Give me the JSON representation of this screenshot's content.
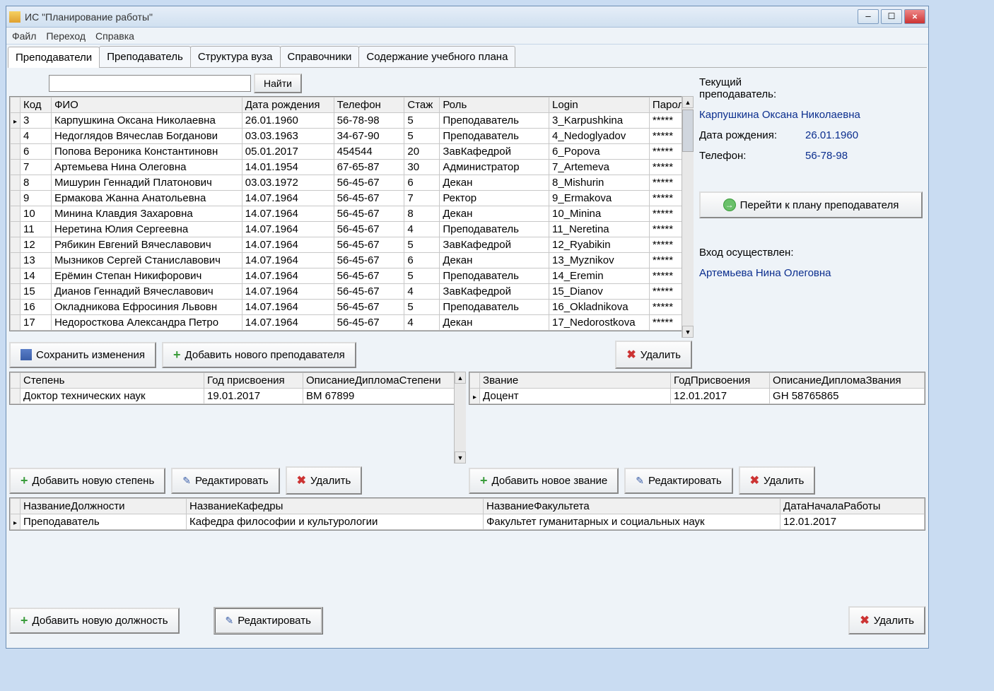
{
  "window": {
    "title": "ИС \"Планирование работы\""
  },
  "menu": {
    "file": "Файл",
    "nav": "Переход",
    "help": "Справка"
  },
  "tabs": {
    "t1": "Преподаватели",
    "t2": "Преподаватель",
    "t3": "Структура вуза",
    "t4": "Справочники",
    "t5": "Содержание учебного плана"
  },
  "search": {
    "btn": "Найти"
  },
  "teachers": {
    "headers": {
      "code": "Код",
      "fio": "ФИО",
      "dob": "Дата рождения",
      "tel": "Телефон",
      "stazh": "Стаж",
      "role": "Роль",
      "login": "Login",
      "pwd": "Пароль"
    },
    "rows": [
      {
        "code": "3",
        "fio": "Карпушкина Оксана  Николаевна",
        "dob": "26.01.1960",
        "tel": "56-78-98",
        "stazh": "5",
        "role": "Преподаватель",
        "login": "3_Karpushkina",
        "pwd": "*****"
      },
      {
        "code": "4",
        "fio": "Недоглядов Вячеслав  Богданови",
        "dob": "03.03.1963",
        "tel": "34-67-90",
        "stazh": "5",
        "role": "Преподаватель",
        "login": "4_Nedoglyadov",
        "pwd": "*****"
      },
      {
        "code": "6",
        "fio": "Попова Вероника  Константиновн",
        "dob": "05.01.2017",
        "tel": "454544",
        "stazh": "20",
        "role": "ЗавКафедрой",
        "login": "6_Popova",
        "pwd": "*****"
      },
      {
        "code": "7",
        "fio": "Артемьева Нина  Олеговна",
        "dob": "14.01.1954",
        "tel": "67-65-87",
        "stazh": "30",
        "role": "Администратор",
        "login": "7_Artemeva",
        "pwd": "*****"
      },
      {
        "code": "8",
        "fio": "Мишурин Геннадий  Платонович",
        "dob": "03.03.1972",
        "tel": "56-45-67",
        "stazh": "6",
        "role": "Декан",
        "login": "8_Mishurin",
        "pwd": "*****"
      },
      {
        "code": "9",
        "fio": "Ермакова Жанна Анатольевна",
        "dob": "14.07.1964",
        "tel": "56-45-67",
        "stazh": "7",
        "role": "Ректор",
        "login": "9_Ermakova",
        "pwd": "*****"
      },
      {
        "code": "10",
        "fio": "Минина Клавдия  Захаровна",
        "dob": "14.07.1964",
        "tel": "56-45-67",
        "stazh": "8",
        "role": "Декан",
        "login": "10_Minina",
        "pwd": "*****"
      },
      {
        "code": "11",
        "fio": "Неретина Юлия  Сергеевна",
        "dob": "14.07.1964",
        "tel": "56-45-67",
        "stazh": "4",
        "role": "Преподаватель",
        "login": "11_Neretina",
        "pwd": "*****"
      },
      {
        "code": "12",
        "fio": "Рябикин Евгений  Вячеславович",
        "dob": "14.07.1964",
        "tel": "56-45-67",
        "stazh": "5",
        "role": "ЗавКафедрой",
        "login": "12_Ryabikin",
        "pwd": "*****"
      },
      {
        "code": "13",
        "fio": "Мызников Сергей  Станиславович",
        "dob": "14.07.1964",
        "tel": "56-45-67",
        "stazh": "6",
        "role": "Декан",
        "login": "13_Myznikov",
        "pwd": "*****"
      },
      {
        "code": "14",
        "fio": "Ерёмин Степан  Никифорович",
        "dob": "14.07.1964",
        "tel": "56-45-67",
        "stazh": "5",
        "role": "Преподаватель",
        "login": "14_Eremin",
        "pwd": "*****"
      },
      {
        "code": "15",
        "fio": "Дианов Геннадий  Вячеславович",
        "dob": "14.07.1964",
        "tel": "56-45-67",
        "stazh": "4",
        "role": "ЗавКафедрой",
        "login": "15_Dianov",
        "pwd": "*****"
      },
      {
        "code": "16",
        "fio": "Окладникова Ефросиния  Львовн",
        "dob": "14.07.1964",
        "tel": "56-45-67",
        "stazh": "5",
        "role": "Преподаватель",
        "login": "16_Okladnikova",
        "pwd": "*****"
      },
      {
        "code": "17",
        "fio": "Недоросткова Александра  Петро",
        "dob": "14.07.1964",
        "tel": "56-45-67",
        "stazh": "4",
        "role": "Декан",
        "login": "17_Nedorostkova",
        "pwd": "*****"
      }
    ]
  },
  "side": {
    "current_lbl": "Текущий преподаватель:",
    "current_name": "Карпушкина Оксана  Николаевна",
    "dob_lbl": "Дата рождения:",
    "dob_val": "26.01.1960",
    "tel_lbl": "Телефон:",
    "tel_val": "56-78-98",
    "goto_plan": "Перейти к плану преподавателя",
    "login_lbl": "Вход осуществлен:",
    "login_name": "Артемьева Нина  Олеговна"
  },
  "toolbar1": {
    "save": "Сохранить изменения",
    "add": "Добавить нового преподавателя",
    "del": "Удалить"
  },
  "degree": {
    "headers": {
      "name": "Степень",
      "year": "Год присвоения",
      "desc": "ОписаниеДипломаСтепени"
    },
    "rows": [
      {
        "name": "Доктор технических наук",
        "year": "19.01.2017",
        "desc": "ВМ 67899"
      }
    ],
    "add": "Добавить новую степень",
    "edit": "Редактировать",
    "del": "Удалить"
  },
  "rank": {
    "headers": {
      "name": "Звание",
      "year": "ГодПрисвоения",
      "desc": "ОписаниеДипломаЗвания"
    },
    "rows": [
      {
        "name": "Доцент",
        "year": "12.01.2017",
        "desc": "GH 58765865"
      }
    ],
    "add": "Добавить новое звание",
    "edit": "Редактировать",
    "del": "Удалить"
  },
  "position": {
    "headers": {
      "pos": "НазваниеДолжности",
      "dept": "НазваниеКафедры",
      "fac": "НазваниеФакультета",
      "date": "ДатаНачалаРаботы"
    },
    "rows": [
      {
        "pos": "Преподаватель",
        "dept": "Кафедра философии и культурологии",
        "fac": "Факультет гуманитарных и социальных наук",
        "date": "12.01.2017"
      }
    ],
    "add": "Добавить новую должность",
    "edit": "Редактировать",
    "del": "Удалить"
  }
}
